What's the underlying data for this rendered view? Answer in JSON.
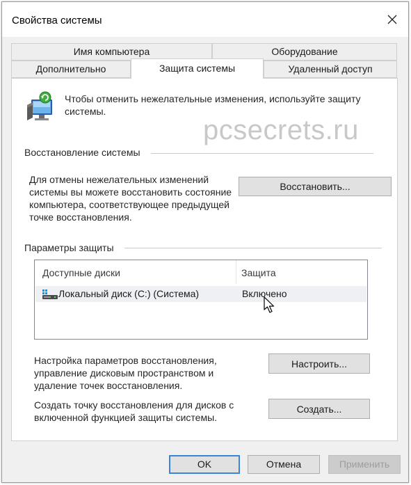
{
  "window": {
    "title": "Свойства системы"
  },
  "tabs": {
    "row1": [
      "Имя компьютера",
      "Оборудование"
    ],
    "row2": [
      "Дополнительно",
      "Защита системы",
      "Удаленный доступ"
    ]
  },
  "intro": "Чтобы отменить нежелательные изменения, используйте защиту системы.",
  "watermark": "pcsecrets.ru",
  "restore": {
    "group_title": "Восстановление системы",
    "description": "Для отмены нежелательных изменений системы вы можете восстановить состояние компьютера, соответствующее предыдущей точке восстановления.",
    "button": "Восстановить..."
  },
  "protection": {
    "group_title": "Параметры защиты",
    "columns": [
      "Доступные диски",
      "Защита"
    ],
    "rows": [
      {
        "disk": "Локальный диск (C:) (Система)",
        "status": "Включено"
      }
    ],
    "configure_text": "Настройка параметров восстановления, управление дисковым пространством и удаление точек восстановления.",
    "configure_button": "Настроить...",
    "create_text": "Создать точку восстановления для дисков с включенной функцией защиты системы.",
    "create_button": "Создать..."
  },
  "footer": {
    "ok": "OK",
    "cancel": "Отмена",
    "apply": "Применить"
  },
  "colors": {
    "accent_border": "#3c84d9",
    "window_bg": "#f0f0f0",
    "panel_bg": "#ffffff"
  }
}
